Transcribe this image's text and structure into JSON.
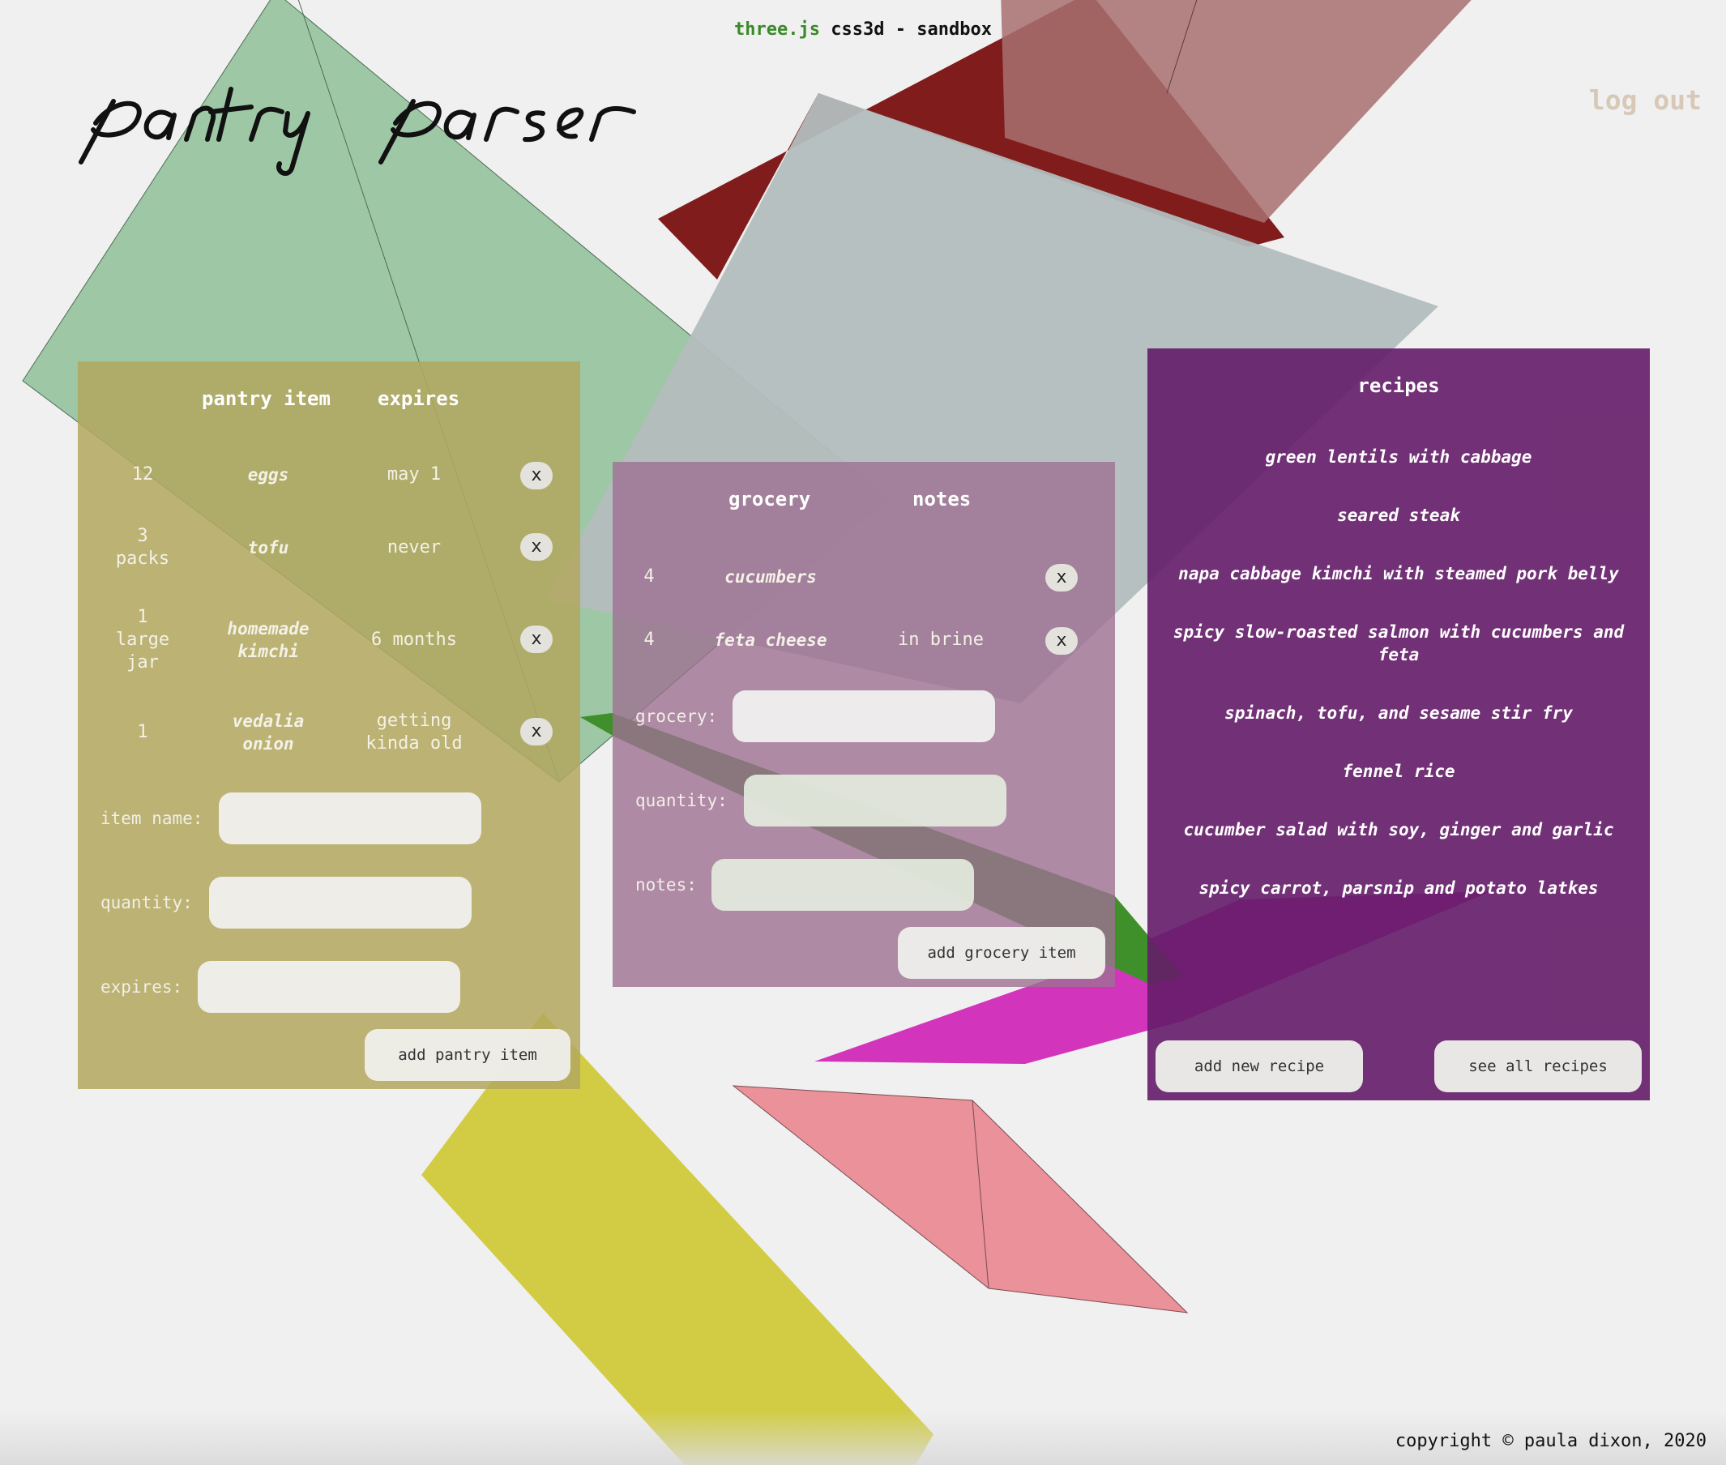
{
  "header": {
    "info_link": "three.js",
    "info_text": "css3d - sandbox",
    "logo_text": "pantry parser",
    "logout_label": "log out"
  },
  "pantry": {
    "col_item": "pantry item",
    "col_expires": "expires",
    "rows": [
      {
        "qty": "12",
        "name": "eggs",
        "expires": "may 1"
      },
      {
        "qty": "3\npacks",
        "name": "tofu",
        "expires": "never"
      },
      {
        "qty": "1\nlarge\njar",
        "name": "homemade\nkimchi",
        "expires": "6 months"
      },
      {
        "qty": "1",
        "name": "vedalia\nonion",
        "expires": "getting\nkinda old"
      }
    ],
    "delete_label": "x",
    "label_item_name": "item name:",
    "label_quantity": "quantity:",
    "label_expires": "expires:",
    "item_name_value": "",
    "quantity_value": "",
    "expires_value": "",
    "add_label": "add pantry item"
  },
  "grocery": {
    "col_grocery": "grocery",
    "col_notes": "notes",
    "rows": [
      {
        "qty": "4",
        "name": "cucumbers",
        "notes": ""
      },
      {
        "qty": "4",
        "name": "feta cheese",
        "notes": "in brine"
      }
    ],
    "delete_label": "x",
    "label_grocery": "grocery:",
    "label_quantity": "quantity:",
    "label_notes": "notes:",
    "grocery_value": "",
    "quantity_value": "",
    "notes_value": "",
    "add_label": "add grocery item"
  },
  "recipes": {
    "title": "recipes",
    "items": [
      "green lentils with cabbage",
      "seared steak",
      "napa cabbage kimchi with steamed pork belly",
      "spicy slow-roasted salmon with cucumbers and feta",
      "spinach, tofu, and sesame stir fry",
      "fennel rice",
      "cucumber salad with soy, ginger and garlic",
      "spicy carrot, parsnip and potato latkes"
    ],
    "add_label": "add new recipe",
    "see_all_label": "see all recipes"
  },
  "footer": {
    "copyright": "copyright © paula dixon, 2020"
  },
  "colors": {
    "background": "#f0f0f0",
    "pantry_panel": "#b2a860",
    "grocery_panel": "#9e7092",
    "recipes_panel": "#641c68",
    "logout_text": "#d7c8b8",
    "threejs_link": "#3a8a2a"
  }
}
